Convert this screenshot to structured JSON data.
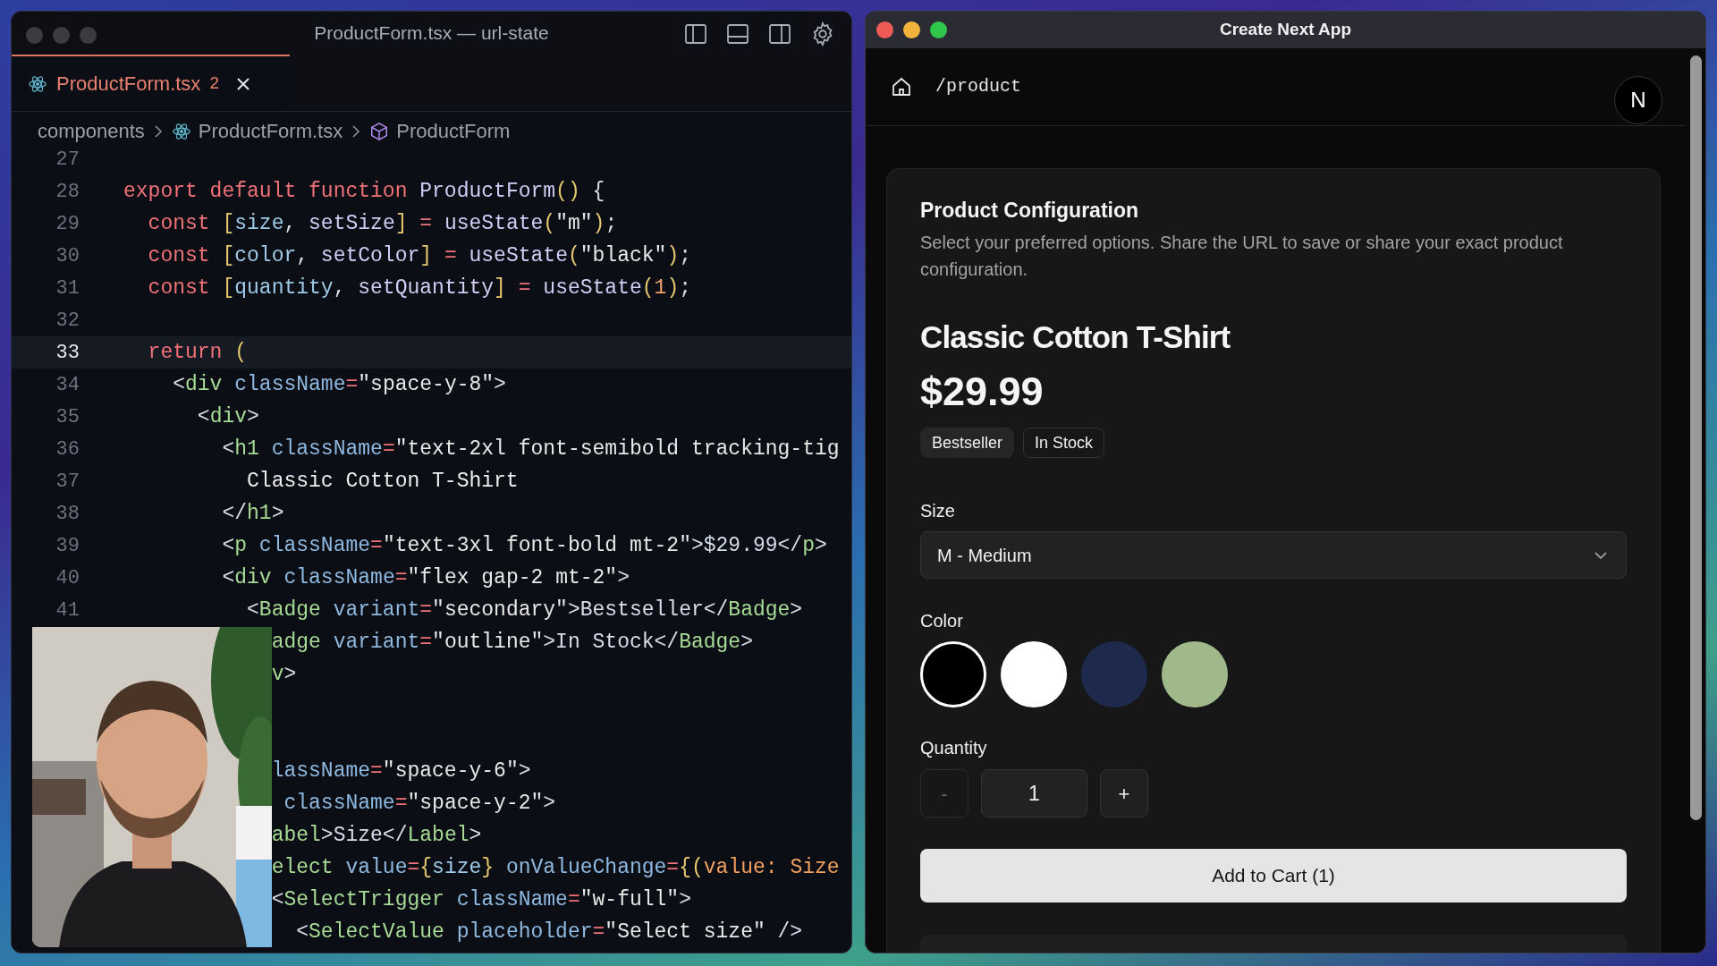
{
  "editor": {
    "title": "ProductForm.tsx — url-state",
    "tabs": [
      {
        "label": "ProductForm.tsx",
        "badge": "2",
        "selected": true
      }
    ],
    "breadcrumb": [
      {
        "label": "components",
        "kind": "folder"
      },
      {
        "label": "ProductForm.tsx",
        "kind": "file"
      },
      {
        "label": "ProductForm",
        "kind": "symbol"
      }
    ],
    "lines": [
      {
        "number": "27",
        "current": false
      },
      {
        "number": "28",
        "current": false,
        "tokens": [
          {
            "text": "export default function ",
            "kind": "kw"
          },
          {
            "text": "ProductForm",
            "kind": "fn"
          },
          {
            "text": "()",
            "kind": "br"
          },
          {
            "text": " {",
            "kind": "punct"
          }
        ]
      },
      {
        "number": "29",
        "current": false,
        "tokens": [
          {
            "text": "  const ",
            "kind": "kw"
          },
          {
            "text": "[",
            "kind": "br"
          },
          {
            "text": "size",
            "kind": "var"
          },
          {
            "text": ", ",
            "kind": "punct"
          },
          {
            "text": "setSize",
            "kind": "fn"
          },
          {
            "text": "]",
            "kind": "br"
          },
          {
            "text": " = ",
            "kind": "op"
          },
          {
            "text": "useState",
            "kind": "fn"
          },
          {
            "text": "(",
            "kind": "br"
          },
          {
            "text": "\"m\"",
            "kind": "str"
          },
          {
            "text": ")",
            "kind": "br"
          },
          {
            "text": ";",
            "kind": "punct"
          }
        ]
      },
      {
        "number": "30",
        "current": false,
        "tokens": [
          {
            "text": "  const ",
            "kind": "kw"
          },
          {
            "text": "[",
            "kind": "br"
          },
          {
            "text": "color",
            "kind": "var"
          },
          {
            "text": ", ",
            "kind": "punct"
          },
          {
            "text": "setColor",
            "kind": "fn"
          },
          {
            "text": "]",
            "kind": "br"
          },
          {
            "text": " = ",
            "kind": "op"
          },
          {
            "text": "useState",
            "kind": "fn"
          },
          {
            "text": "(",
            "kind": "br"
          },
          {
            "text": "\"black\"",
            "kind": "str"
          },
          {
            "text": ")",
            "kind": "br"
          },
          {
            "text": ";",
            "kind": "punct"
          }
        ]
      },
      {
        "number": "31",
        "current": false,
        "tokens": [
          {
            "text": "  const ",
            "kind": "kw"
          },
          {
            "text": "[",
            "kind": "br"
          },
          {
            "text": "quantity",
            "kind": "var"
          },
          {
            "text": ", ",
            "kind": "punct"
          },
          {
            "text": "setQuantity",
            "kind": "fn"
          },
          {
            "text": "]",
            "kind": "br"
          },
          {
            "text": " = ",
            "kind": "op"
          },
          {
            "text": "useState",
            "kind": "fn"
          },
          {
            "text": "(",
            "kind": "br"
          },
          {
            "text": "1",
            "kind": "num"
          },
          {
            "text": ")",
            "kind": "br"
          },
          {
            "text": ";",
            "kind": "punct"
          }
        ]
      },
      {
        "number": "32",
        "current": false
      },
      {
        "number": "33",
        "current": true,
        "tokens": [
          {
            "text": "  return ",
            "kind": "kw"
          },
          {
            "text": "(",
            "kind": "br"
          }
        ]
      },
      {
        "number": "34",
        "current": false,
        "tokens": [
          {
            "text": "    <",
            "kind": "punct"
          },
          {
            "text": "div",
            "kind": "tag"
          },
          {
            "text": " className",
            "kind": "attr"
          },
          {
            "text": "=",
            "kind": "op"
          },
          {
            "text": "\"space-y-8\"",
            "kind": "str"
          },
          {
            "text": ">",
            "kind": "punct"
          }
        ]
      },
      {
        "number": "35",
        "current": false,
        "tokens": [
          {
            "text": "      <",
            "kind": "punct"
          },
          {
            "text": "div",
            "kind": "tag"
          },
          {
            "text": ">",
            "kind": "punct"
          }
        ]
      },
      {
        "number": "36",
        "current": false,
        "tokens": [
          {
            "text": "        <",
            "kind": "punct"
          },
          {
            "text": "h1",
            "kind": "tag"
          },
          {
            "text": " className",
            "kind": "attr"
          },
          {
            "text": "=",
            "kind": "op"
          },
          {
            "text": "\"text-2xl font-semibold tracking-tig",
            "kind": "str"
          }
        ]
      },
      {
        "number": "37",
        "current": false,
        "tokens": [
          {
            "text": "          Classic Cotton T-Shirt",
            "kind": "txt"
          }
        ]
      },
      {
        "number": "38",
        "current": false,
        "tokens": [
          {
            "text": "        </",
            "kind": "punct"
          },
          {
            "text": "h1",
            "kind": "tag"
          },
          {
            "text": ">",
            "kind": "punct"
          }
        ]
      },
      {
        "number": "39",
        "current": false,
        "tokens": [
          {
            "text": "        <",
            "kind": "punct"
          },
          {
            "text": "p",
            "kind": "tag"
          },
          {
            "text": " className",
            "kind": "attr"
          },
          {
            "text": "=",
            "kind": "op"
          },
          {
            "text": "\"text-3xl font-bold mt-2\"",
            "kind": "str"
          },
          {
            "text": ">$29.99</",
            "kind": "punct"
          },
          {
            "text": "p",
            "kind": "tag"
          },
          {
            "text": ">",
            "kind": "punct"
          }
        ]
      },
      {
        "number": "40",
        "current": false,
        "tokens": [
          {
            "text": "        <",
            "kind": "punct"
          },
          {
            "text": "div",
            "kind": "tag"
          },
          {
            "text": " className",
            "kind": "attr"
          },
          {
            "text": "=",
            "kind": "op"
          },
          {
            "text": "\"flex gap-2 mt-2\"",
            "kind": "str"
          },
          {
            "text": ">",
            "kind": "punct"
          }
        ]
      },
      {
        "number": "41",
        "current": false,
        "tokens": [
          {
            "text": "          <",
            "kind": "punct"
          },
          {
            "text": "Badge",
            "kind": "tag"
          },
          {
            "text": " variant",
            "kind": "attr"
          },
          {
            "text": "=",
            "kind": "op"
          },
          {
            "text": "\"secondary\"",
            "kind": "str"
          },
          {
            "text": ">Bestseller</",
            "kind": "punct"
          },
          {
            "text": "Badge",
            "kind": "tag"
          },
          {
            "text": ">",
            "kind": "punct"
          }
        ]
      },
      {
        "current": false,
        "tokens": [
          {
            "text": "            adge",
            "kind": "tag"
          },
          {
            "text": " variant",
            "kind": "attr"
          },
          {
            "text": "=",
            "kind": "op"
          },
          {
            "text": "\"outline\"",
            "kind": "str"
          },
          {
            "text": ">In Stock</",
            "kind": "punct"
          },
          {
            "text": "Badge",
            "kind": "tag"
          },
          {
            "text": ">",
            "kind": "punct"
          }
        ]
      },
      {
        "current": false,
        "tokens": [
          {
            "text": "            v",
            "kind": "tag"
          },
          {
            "text": ">",
            "kind": "punct"
          }
        ]
      },
      {
        "current": false
      },
      {
        "current": false
      },
      {
        "current": false,
        "tokens": [
          {
            "text": "            lassName",
            "kind": "attr"
          },
          {
            "text": "=",
            "kind": "op"
          },
          {
            "text": "\"space-y-6\"",
            "kind": "str"
          },
          {
            "text": ">",
            "kind": "punct"
          }
        ]
      },
      {
        "current": false,
        "tokens": [
          {
            "text": "             className",
            "kind": "attr"
          },
          {
            "text": "=",
            "kind": "op"
          },
          {
            "text": "\"space-y-2\"",
            "kind": "str"
          },
          {
            "text": ">",
            "kind": "punct"
          }
        ]
      },
      {
        "current": false,
        "tokens": [
          {
            "text": "            abel",
            "kind": "tag"
          },
          {
            "text": ">Size</",
            "kind": "punct"
          },
          {
            "text": "Label",
            "kind": "tag"
          },
          {
            "text": ">",
            "kind": "punct"
          }
        ]
      },
      {
        "current": false,
        "tokens": [
          {
            "text": "            elect",
            "kind": "tag"
          },
          {
            "text": " value",
            "kind": "attr"
          },
          {
            "text": "=",
            "kind": "op"
          },
          {
            "text": "{",
            "kind": "br"
          },
          {
            "text": "size",
            "kind": "var"
          },
          {
            "text": "}",
            "kind": "br"
          },
          {
            "text": " onValueChange",
            "kind": "attr"
          },
          {
            "text": "=",
            "kind": "op"
          },
          {
            "text": "{(",
            "kind": "br"
          },
          {
            "text": "value: Size",
            "kind": "param"
          }
        ]
      },
      {
        "current": false,
        "tokens": [
          {
            "text": "            <",
            "kind": "punct"
          },
          {
            "text": "SelectTrigger",
            "kind": "tag"
          },
          {
            "text": " className",
            "kind": "attr"
          },
          {
            "text": "=",
            "kind": "op"
          },
          {
            "text": "\"w-full\"",
            "kind": "str"
          },
          {
            "text": ">",
            "kind": "punct"
          }
        ]
      },
      {
        "current": false,
        "tokens": [
          {
            "text": "              <",
            "kind": "punct"
          },
          {
            "text": "SelectValue",
            "kind": "tag"
          },
          {
            "text": " placeholder",
            "kind": "attr"
          },
          {
            "text": "=",
            "kind": "op"
          },
          {
            "text": "\"Select size\"",
            "kind": "str"
          },
          {
            "text": " />",
            "kind": "punct"
          }
        ]
      }
    ]
  },
  "browser": {
    "title": "Create Next App",
    "path": "/product",
    "avatar": "N",
    "card": {
      "title": "Product Configuration",
      "description": "Select your preferred options. Share the URL to save or share your exact product configuration.",
      "product_name": "Classic Cotton T-Shirt",
      "price": "$29.99",
      "badges": [
        {
          "label": "Bestseller",
          "kind": "secondary"
        },
        {
          "label": "In Stock",
          "kind": "outline"
        }
      ],
      "size_label": "Size",
      "size_value": "M - Medium",
      "color_label": "Color",
      "colors": [
        {
          "color": "#000000",
          "selected": true
        },
        {
          "color": "#ffffff",
          "selected": false
        },
        {
          "color": "#1d2a4b",
          "selected": false
        },
        {
          "color": "#9fb98b",
          "selected": false
        }
      ],
      "quantity_label": "Quantity",
      "decrement": "-",
      "decrement_disabled": true,
      "quantity": "1",
      "increment": "+",
      "add_to_cart": "Add to Cart (1)"
    }
  }
}
